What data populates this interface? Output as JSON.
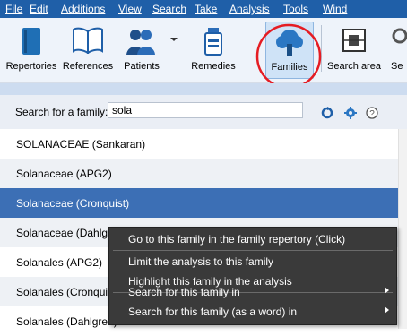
{
  "menubar": {
    "items": [
      "File",
      "Edit",
      "Additions",
      "View",
      "Search",
      "Take",
      "Analysis",
      "Tools",
      "Wind"
    ]
  },
  "toolbar": {
    "buttons": [
      "Repertories",
      "References",
      "Patients",
      "Remedies",
      "Families",
      "Search area",
      "Se"
    ]
  },
  "search": {
    "label": "Search for a family:",
    "value": "sola"
  },
  "families_list": {
    "rows": [
      "SOLANACEAE (Sankaran)",
      "Solanaceae (APG2)",
      "Solanaceae (Cronquist)",
      "Solanaceae (Dahlgren)",
      "Solanales (APG2)",
      "Solanales (Cronquist)",
      "Solanales (Dahlgren)"
    ]
  },
  "context_menu": {
    "items": [
      "Go to this family in the family repertory (Click)",
      "Limit the analysis to this family",
      "Highlight this family in the analysis",
      "Search for this family in",
      "Search for this family (as a word) in"
    ]
  },
  "colors": {
    "menubar": "#1f5fa8",
    "selection": "#3c6fb5",
    "context_menu": "#3a3a3a",
    "annotation_circle": "#e51c23"
  }
}
